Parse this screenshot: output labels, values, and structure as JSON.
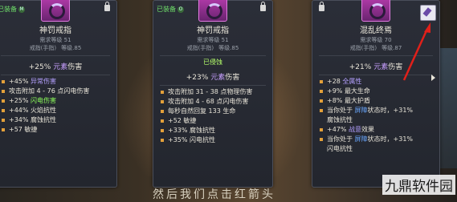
{
  "card1": {
    "equip_label": "已装备",
    "equip_dot": "M",
    "name": "神罚戒指",
    "req_level": "需求等级 51",
    "slot": "戒指(手指)",
    "item_level": "等级.85",
    "dmg_prefix": "+25%",
    "dmg_element": "元素",
    "dmg_suffix": "伤害",
    "stats": [
      {
        "text": "+45%",
        "hl": "异常伤害",
        "cls": "hl"
      },
      {
        "text": "攻击附加 4 - 76 点闪电伤害"
      },
      {
        "text": "+25%",
        "hl": "闪电伤害",
        "cls": "green"
      },
      {
        "text": "+44% 火焰抗性"
      },
      {
        "text": "+34% 腐蚀抗性"
      },
      {
        "text": "+57 敏捷"
      }
    ]
  },
  "card2": {
    "equip_label": "已装备",
    "equip_dot": "O",
    "name": "神罚戒指",
    "req_level": "需求等级 51",
    "slot": "戒指(手指)",
    "item_level": "等级.85",
    "tag": "已侵蚀",
    "dmg_prefix": "+23%",
    "dmg_element": "元素",
    "dmg_suffix": "伤害",
    "stats": [
      {
        "text": "攻击附加 31 - 38 点物理伤害"
      },
      {
        "text": "攻击附加 4 - 68 点闪电伤害"
      },
      {
        "text": "每秒自然回复 133 生命"
      },
      {
        "text": "+52 敏捷"
      },
      {
        "text": "+33% 腐蚀抗性"
      },
      {
        "text": "+35% 闪电抗性"
      }
    ]
  },
  "card3": {
    "name": "混乱终焉",
    "req_level": "需求等级 70",
    "slot": "戒指(手指)",
    "item_level": "等级.87",
    "dmg_prefix": "+21%",
    "dmg_element": "元素",
    "dmg_suffix": "伤害",
    "stats": [
      {
        "text": "+28",
        "hl": "全属性",
        "cls": "hl"
      },
      {
        "text": "+9% 最大生命"
      },
      {
        "text": "+8% 最大护盾"
      },
      {
        "text": "当你处于",
        "hl": "屏障",
        "after": "状态时，+31%",
        "cls": "shield-hl"
      },
      {
        "text": "腐蚀抗性",
        "cont": true
      },
      {
        "text": "+47%",
        "hl": "战意",
        "after": "效果",
        "cls": "hl"
      },
      {
        "text": "当你处于",
        "hl": "屏障",
        "after": "状态时，+31%",
        "cls": "shield-hl"
      },
      {
        "text": "闪电抗性",
        "cont": true
      }
    ]
  },
  "bottom_caption": "然后我们点击红箭头",
  "watermark": "九鼎软件园"
}
